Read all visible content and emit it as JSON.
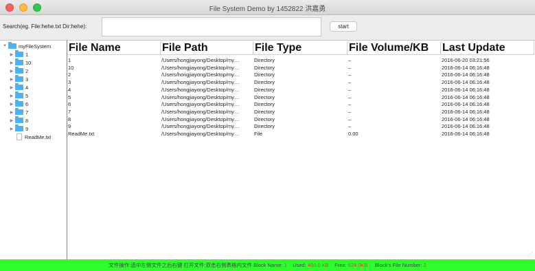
{
  "window": {
    "title": "File System Demo by 1452822 洪嘉勇"
  },
  "search": {
    "label": "Search(eg. File:hehe.txt Dir:hehe):",
    "value": "",
    "start_label": "start"
  },
  "tree": {
    "root": "myFileSystem",
    "items": [
      {
        "label": "1",
        "type": "folder"
      },
      {
        "label": "10",
        "type": "folder"
      },
      {
        "label": "2",
        "type": "folder"
      },
      {
        "label": "3",
        "type": "folder"
      },
      {
        "label": "4",
        "type": "folder"
      },
      {
        "label": "5",
        "type": "folder"
      },
      {
        "label": "6",
        "type": "folder"
      },
      {
        "label": "7",
        "type": "folder"
      },
      {
        "label": "8",
        "type": "folder"
      },
      {
        "label": "9",
        "type": "folder"
      },
      {
        "label": "ReadMe.txt",
        "type": "file"
      }
    ]
  },
  "table": {
    "headers": [
      "File Name",
      "File Path",
      "File Type",
      "File Volume/KB",
      "Last Update"
    ],
    "rows": [
      [
        "1",
        "/Users/hongjiayong/Desktop/my…",
        "Directory",
        "–",
        "2016-06-20 03:21:56"
      ],
      [
        "10",
        "/Users/hongjiayong/Desktop/my…",
        "Directory",
        "–",
        "2016-06-14 06:16:48"
      ],
      [
        "2",
        "/Users/hongjiayong/Desktop/my…",
        "Directory",
        "–",
        "2016-06-14 06:16:48"
      ],
      [
        "3",
        "/Users/hongjiayong/Desktop/my…",
        "Directory",
        "–",
        "2016-06-14 06:16:48"
      ],
      [
        "4",
        "/Users/hongjiayong/Desktop/my…",
        "Directory",
        "–",
        "2016-06-14 06:16:48"
      ],
      [
        "5",
        "/Users/hongjiayong/Desktop/my…",
        "Directory",
        "–",
        "2016-06-14 06:16:48"
      ],
      [
        "6",
        "/Users/hongjiayong/Desktop/my…",
        "Directory",
        "–",
        "2016-06-14 06:16:48"
      ],
      [
        "7",
        "/Users/hongjiayong/Desktop/my…",
        "Directory",
        "–",
        "2016-06-14 06:16:48"
      ],
      [
        "8",
        "/Users/hongjiayong/Desktop/my…",
        "Directory",
        "–",
        "2016-06-14 06:16:48"
      ],
      [
        "9",
        "/Users/hongjiayong/Desktop/my…",
        "Directory",
        "–",
        "2016-06-14 06:16:48"
      ],
      [
        "ReadMe.txt",
        "/Users/hongjiayong/Desktop/my…",
        "File",
        "0.00",
        "2016-06-14 06:16:48"
      ]
    ]
  },
  "status": {
    "instructions": "文件操作:选中左侧文件之后右键 打开文件:双击右侧表格内文件",
    "block_name_label": "Block Name:",
    "block_name_value": "1",
    "used_label": "Used:",
    "used_value": "400.0 KB",
    "free_label": "Free:",
    "free_value": "624.0KB",
    "file_number_label": "Block's File Number:",
    "file_number_value": "2"
  },
  "colors": {
    "status_bar": "#2dff2d",
    "status_value": "#ff2a2a",
    "folder": "#4db3f0",
    "tree_border": "#5a8ed6"
  }
}
